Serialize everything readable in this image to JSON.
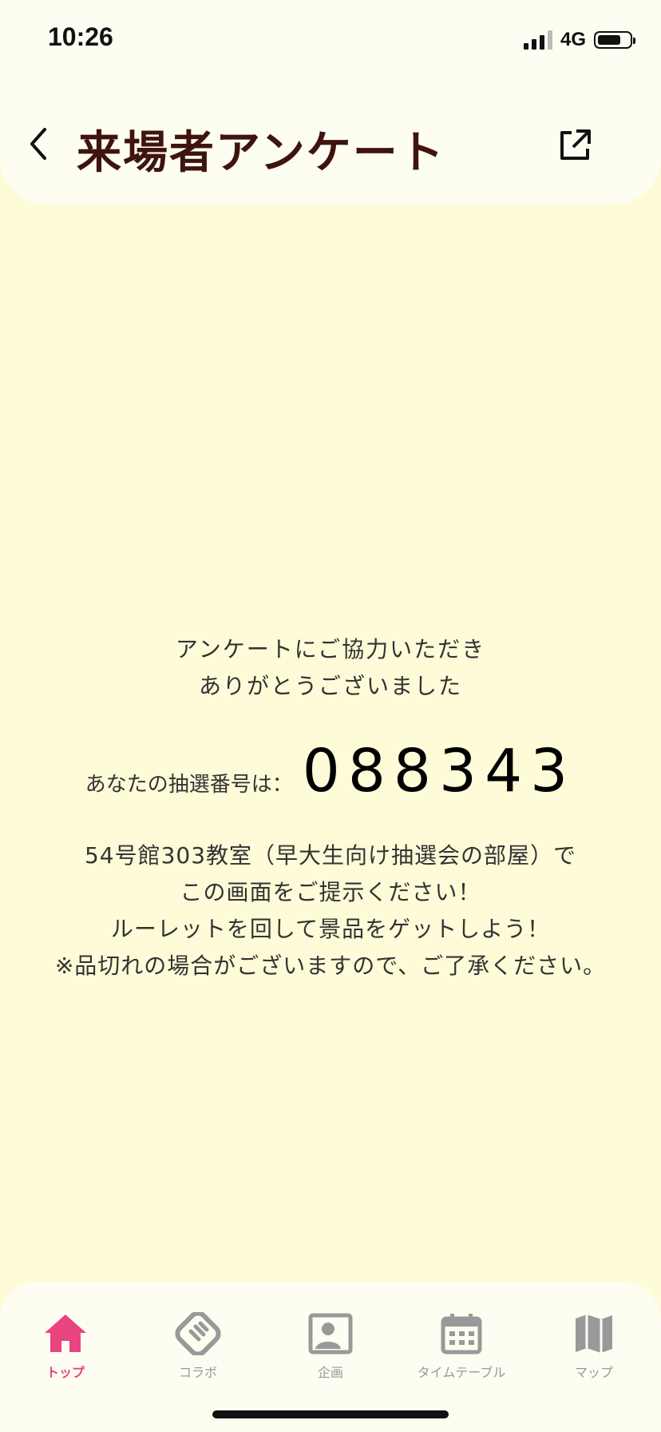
{
  "status": {
    "time": "10:26",
    "network": "4G"
  },
  "header": {
    "title": "来場者アンケート"
  },
  "message": {
    "thanks_line1": "アンケートにご協力いただき",
    "thanks_line2": "ありがとうございました",
    "lottery_label": "あなたの抽選番号は：",
    "lottery_number": "088343",
    "info_lines": [
      "54号館303教室（早大生向け抽選会の部屋）で",
      "この画面をご提示ください！",
      "ルーレットを回して景品をゲットしよう！",
      "※品切れの場合がございますので、ご了承ください。"
    ]
  },
  "tabs": [
    {
      "label": "トップ",
      "icon": "home-icon",
      "active": true
    },
    {
      "label": "コラボ",
      "icon": "handshake-icon",
      "active": false
    },
    {
      "label": "企画",
      "icon": "id-card-icon",
      "active": false
    },
    {
      "label": "タイムテーブル",
      "icon": "calendar-icon",
      "active": false
    },
    {
      "label": "マップ",
      "icon": "map-icon",
      "active": false
    }
  ],
  "colors": {
    "background": "#fdfbd8",
    "title": "#3e140d",
    "accent": "#e8447f",
    "inactive": "#999999"
  }
}
